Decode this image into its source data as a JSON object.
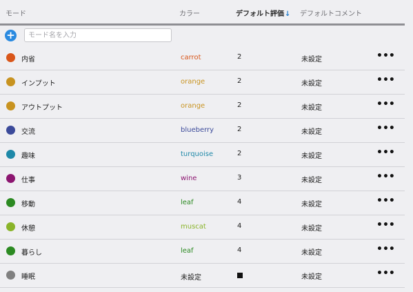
{
  "header": {
    "mode": "モード",
    "color": "カラー",
    "rating": "デフォルト評価",
    "rating_sort": "↓",
    "comment": "デフォルトコメント"
  },
  "add": {
    "button": "+",
    "placeholder": "モード名を入力"
  },
  "more_label": "•••",
  "rows": [
    {
      "name": "内省",
      "color_name": "carrot",
      "color": "#d9561a",
      "rating": "2",
      "comment": "未設定"
    },
    {
      "name": "インプット",
      "color_name": "orange",
      "color": "#c89320",
      "rating": "2",
      "comment": "未設定"
    },
    {
      "name": "アウトプット",
      "color_name": "orange",
      "color": "#c89320",
      "rating": "2",
      "comment": "未設定"
    },
    {
      "name": "交流",
      "color_name": "blueberry",
      "color": "#3b4a9a",
      "rating": "2",
      "comment": "未設定"
    },
    {
      "name": "趣味",
      "color_name": "turquoise",
      "color": "#1e88a8",
      "rating": "2",
      "comment": "未設定"
    },
    {
      "name": "仕事",
      "color_name": "wine",
      "color": "#8c1670",
      "rating": "3",
      "comment": "未設定"
    },
    {
      "name": "移動",
      "color_name": "leaf",
      "color": "#2c8a22",
      "rating": "4",
      "comment": "未設定"
    },
    {
      "name": "休憩",
      "color_name": "muscat",
      "color": "#8ab42a",
      "rating": "4",
      "comment": "未設定"
    },
    {
      "name": "暮らし",
      "color_name": "leaf",
      "color": "#2c8a22",
      "rating": "4",
      "comment": "未設定"
    },
    {
      "name": "睡眠",
      "color_name": "未設定",
      "color": "#808080",
      "color_name_color": "#1c1c1c",
      "rating": "",
      "rating_square": true,
      "comment": "未設定"
    }
  ]
}
